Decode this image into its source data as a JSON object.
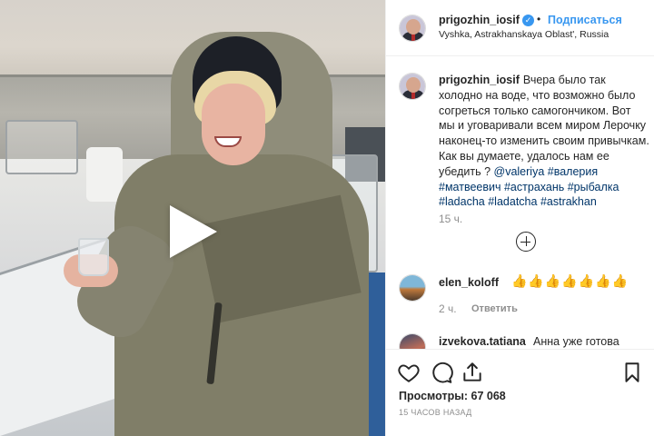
{
  "post": {
    "username": "prigozhin_iosif",
    "verified_icon": "verified-badge-icon",
    "dot": "•",
    "follow_label": "Подписаться",
    "location": "Vyshka, Astrakhanskaya Oblast', Russia"
  },
  "caption": {
    "username": "prigozhin_iosif",
    "text": "Вчера было так холодно на воде, что возможно было согреться только самогончиком. Вот мы и уговаривали всем миром Лерочку наконец-то изменить своим привычкам. Как вы думаете, удалось нам ее убедить ?",
    "mention": "@valeriya",
    "tags": [
      "#валерия",
      "#матвеевич",
      "#астрахань",
      "#рыбалка",
      "#ladacha",
      "#ladatcha",
      "#astrakhan"
    ],
    "time": "15 ч."
  },
  "comments": [
    {
      "username": "elen_koloff",
      "text": "👍👍👍👍👍👍👍",
      "time": "2 ч.",
      "reply_label": "Ответить"
    },
    {
      "username": "izvekova.tatiana",
      "text": "Анна уже готова"
    }
  ],
  "stats": {
    "views_label": "Просмотры:",
    "views_value": "67 068",
    "ago": "15 ЧАСОВ НАЗАД"
  },
  "icons": {
    "play": "play-icon",
    "more": "add-circle-icon",
    "heart": "heart-icon",
    "comment": "comment-icon",
    "share": "share-icon",
    "bookmark": "bookmark-icon"
  },
  "colors": {
    "link": "#3897f0",
    "hashtag": "#003569",
    "muted": "#8e8e8e"
  }
}
